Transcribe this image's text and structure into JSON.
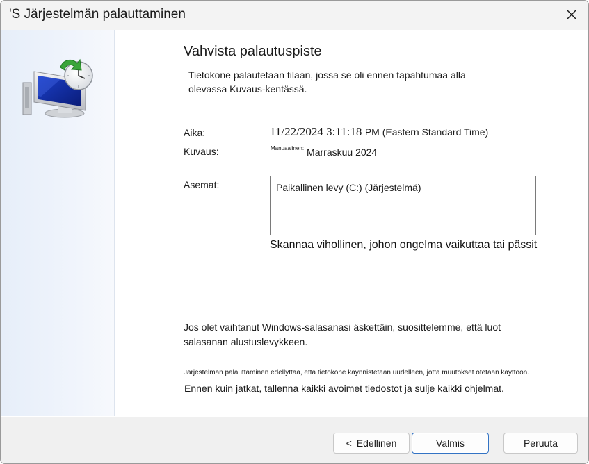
{
  "window": {
    "title": "'S Järjestelmän palauttaminen"
  },
  "main": {
    "heading": "Vahvista palautuspiste",
    "intro": "Tietokone palautetaan tilaan, jossa se oli ennen tapahtumaa alla olevassa Kuvaus-kentässä.",
    "time_label": "Aika:",
    "time_date": "11/22/2024 3:11:18",
    "time_ampm": "PM (Eastern Standard Time)",
    "description_label": "Kuvaus:",
    "description_prefix": "Manuaalinen:",
    "description_value": "Marraskuu 2024",
    "drives_label": "Asemat:",
    "drives": [
      "Paikallinen levy (C:) (Järjestelmä)"
    ],
    "scan_link_underlined": "Skannaa vihollinen, joh",
    "scan_link_rest": "on ongelma vaikuttaa tai pässit",
    "password_note": "Jos olet vaihtanut Windows-salasanasi äskettäin, suosittelemme, että luot salasanan alustuslevykkeen.",
    "restart_note": "Järjestelmän palauttaminen edellyttää, että tietokone käynnistetään uudelleen, jotta muutokset otetaan käyttöön.",
    "save_note": "Ennen kuin jatkat, tallenna kaikki avoimet tiedostot ja sulje kaikki ohjelmat."
  },
  "footer": {
    "back_label": "Edellinen",
    "finish_label": "Valmis",
    "cancel_label": "Peruuta"
  },
  "icons": {
    "close": "close-icon",
    "back": "chevron-left-icon",
    "system_restore": "system-restore-icon"
  },
  "colors": {
    "sidebar": "#e6eef9",
    "default_button_border": "#3373c4",
    "arrow_green": "#3aa53a"
  }
}
